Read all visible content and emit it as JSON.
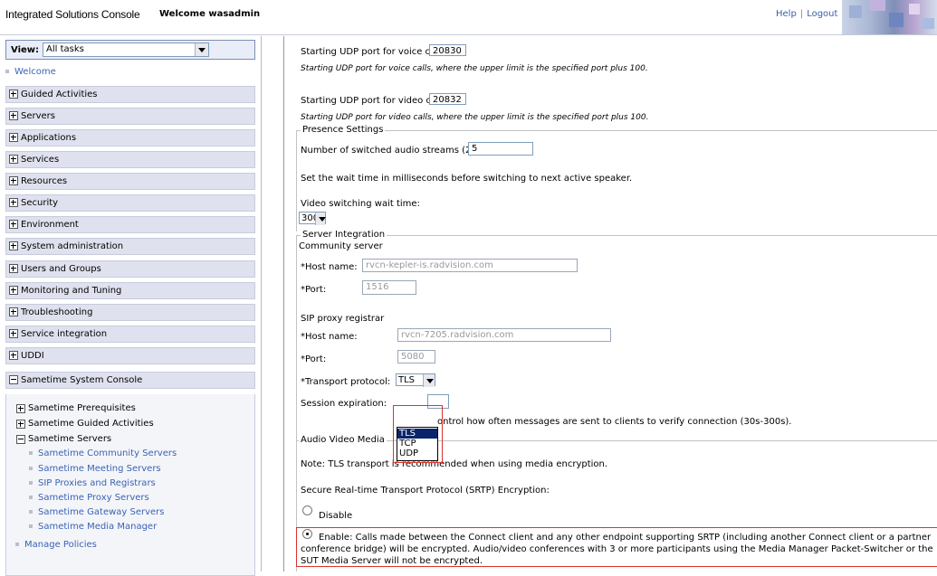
{
  "header": {
    "app_title": "Integrated Solutions Console",
    "welcome": "Welcome wasadmin",
    "help": "Help",
    "separator": "|",
    "logout": "Logout"
  },
  "sidebar": {
    "view_label": "View:",
    "view_value": "All tasks",
    "welcome_link": "Welcome",
    "items": [
      {
        "label": "Guided Activities"
      },
      {
        "label": "Servers"
      },
      {
        "label": "Applications"
      },
      {
        "label": "Services"
      },
      {
        "label": "Resources"
      },
      {
        "label": "Security"
      },
      {
        "label": "Environment"
      },
      {
        "label": "System administration"
      },
      {
        "label": "Users and Groups"
      },
      {
        "label": "Monitoring and Tuning"
      },
      {
        "label": "Troubleshooting"
      },
      {
        "label": "Service integration"
      },
      {
        "label": "UDDI"
      },
      {
        "label": "Sametime System Console"
      }
    ],
    "sametime": {
      "prereq": "Sametime Prerequisites",
      "guided": "Sametime Guided Activities",
      "servers": "Sametime Servers",
      "leaves": [
        "Sametime Community Servers",
        "Sametime Meeting Servers",
        "SIP Proxies and Registrars",
        "Sametime Proxy Servers",
        "Sametime Gateway Servers",
        "Sametime Media Manager"
      ],
      "manage_policies": "Manage Policies"
    }
  },
  "main": {
    "udp_voice_label": "Starting UDP port for voice call:",
    "udp_voice_value": "20830",
    "udp_voice_help": "Starting UDP port for voice calls, where the upper limit is the specified port plus 100.",
    "udp_video_label": "Starting UDP port for video call:",
    "udp_video_value": "20832",
    "udp_video_help": "Starting UDP port for video calls, where the upper limit is the specified port plus 100.",
    "presence": {
      "legend": "Presence Settings",
      "streams_label": "Number of switched audio streams (2-16):",
      "streams_value": "5",
      "wait_desc": "Set the wait time in milliseconds before switching to next active speaker.",
      "wait_label": "Video switching wait time:",
      "wait_value": "3000"
    },
    "server_integration": {
      "legend": "Server Integration",
      "community_title": "Community server",
      "community_host_label": "*Host name:",
      "community_host_value": "rvcn-kepler-is.radvision.com",
      "community_port_label": "*Port:",
      "community_port_value": "1516",
      "sip_title": "SIP proxy registrar",
      "sip_host_label": "*Host name:",
      "sip_host_value": "rvcn-7205.radvision.com",
      "sip_port_label": "*Port:",
      "sip_port_value": "5080",
      "transport_label": "*Transport protocol:",
      "transport_value": "TLS",
      "transport_options": [
        "TLS",
        "TCP",
        "UDP"
      ],
      "session_label": "Session expiration:",
      "session_help_tail": "ontrol how often messages are sent to clients to verify connection (30s-300s)."
    },
    "av_media": {
      "legend": "Audio Video Media",
      "note": "Note: TLS transport is recommended when using media encryption.",
      "srtp_label": "Secure Real-time Transport Protocol (SRTP) Encryption:",
      "disable_label": "Disable",
      "enable_line1": "Enable: Calls made between the Connect client and any other endpoint supporting SRTP (including another Connect client or a partner",
      "enable_line2": "conference bridge) will be encrypted. Audio/video conferences with 3 or more participants using the Media Manager Packet-Switcher or the",
      "enable_line3": "SUT Media Server will not be encrypted."
    }
  }
}
